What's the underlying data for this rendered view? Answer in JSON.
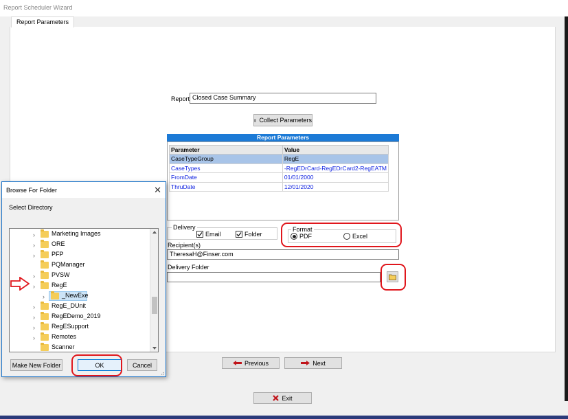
{
  "window": {
    "title": "Report Scheduler Wizard"
  },
  "tabs": [
    {
      "label": "Report Parameters"
    }
  ],
  "report": {
    "label": "Report",
    "value": "Closed Case Summary"
  },
  "collect_button": {
    "label": "Collect Parameters"
  },
  "grid": {
    "title": "Report Parameters",
    "columns": [
      "Parameter",
      "Value"
    ],
    "rows": [
      {
        "param": "CaseTypeGroup",
        "value": "RegE",
        "selected": true
      },
      {
        "param": "CaseTypes",
        "value": "-RegEDrCard-RegEDrCard2-RegEATM"
      },
      {
        "param": "FromDate",
        "value": "01/01/2000"
      },
      {
        "param": "ThruDate",
        "value": "12/01/2020"
      }
    ]
  },
  "delivery": {
    "label": "Delivery",
    "email": "Email",
    "folder": "Folder",
    "email_checked": true,
    "folder_checked": true
  },
  "format": {
    "label": "Format",
    "pdf": "PDF",
    "excel": "Excel",
    "selected": "PDF"
  },
  "recipients": {
    "label": "Recipient(s)",
    "value": "TheresaH@Finser.com"
  },
  "delivery_folder": {
    "label": "Delivery Folder",
    "value": ""
  },
  "nav": {
    "previous": "Previous",
    "next": "Next",
    "exit": "Exit"
  },
  "dialog": {
    "title": "Browse For Folder",
    "close": "✕",
    "prompt": "Select Directory",
    "tree": [
      {
        "name": "Marketing Images",
        "chevron": true,
        "level": 0
      },
      {
        "name": "ORE",
        "chevron": true,
        "level": 0
      },
      {
        "name": "PFP",
        "chevron": true,
        "level": 0
      },
      {
        "name": "PQManager",
        "chevron": false,
        "level": 0
      },
      {
        "name": "PVSW",
        "chevron": true,
        "level": 0
      },
      {
        "name": "RegE",
        "chevron": true,
        "level": 0
      },
      {
        "name": "_NewExe",
        "chevron": true,
        "level": 1,
        "selected": true
      },
      {
        "name": "RegE_DUnit",
        "chevron": true,
        "level": 0
      },
      {
        "name": "RegEDemo_2019",
        "chevron": true,
        "level": 0
      },
      {
        "name": "RegESupport",
        "chevron": true,
        "level": 0
      },
      {
        "name": "Remotes",
        "chevron": true,
        "level": 0
      },
      {
        "name": "Scanner",
        "chevron": false,
        "level": 0
      }
    ],
    "buttons": {
      "new_folder": "Make New Folder",
      "ok": "OK",
      "cancel": "Cancel"
    }
  },
  "colors": {
    "accent": "#1c7ad6",
    "annotation_red": "#e0161c",
    "link_blue": "#0b1ee0"
  }
}
